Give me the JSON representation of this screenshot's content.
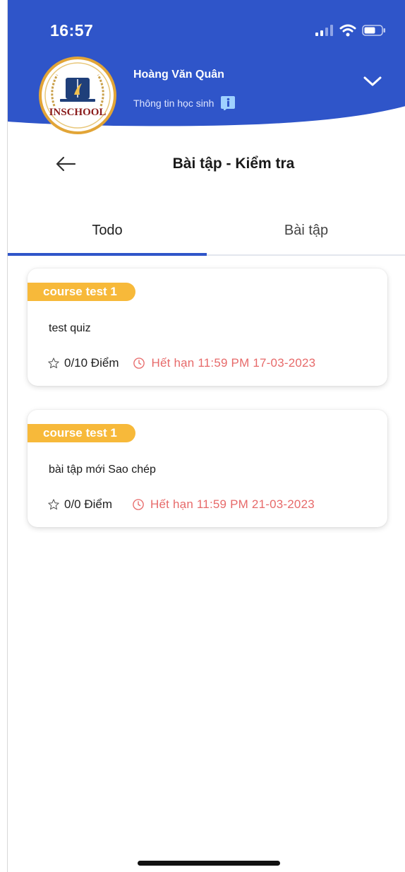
{
  "status_bar": {
    "time": "16:57",
    "icons": [
      "cellular-signal-icon",
      "wifi-icon",
      "battery-icon"
    ]
  },
  "header": {
    "logo_text": "INSCHOOL",
    "user_name": "Hoàng Văn Quân",
    "subtitle": "Thông tin học sinh",
    "info_icon": "info-icon",
    "dropdown_icon": "chevron-down-icon",
    "brand_color": "#2f55c9"
  },
  "page": {
    "back_icon": "arrow-left-icon",
    "title": "Bài tập - Kiểm tra"
  },
  "tabs": [
    {
      "label": "Todo",
      "active": true
    },
    {
      "label": "Bài tập",
      "active": false
    }
  ],
  "assignments": [
    {
      "course": "course test 1",
      "title": "test quiz",
      "score": "0/10 Điểm",
      "deadline": "Hết hạn 11:59 PM 17-03-2023"
    },
    {
      "course": "course test 1",
      "title": "bài tập mới Sao chép",
      "score": "0/0 Điểm",
      "deadline": "Hết hạn 11:59 PM 21-03-2023"
    }
  ],
  "colors": {
    "tag": "#f7b93a",
    "deadline": "#e76a6a",
    "tab_indicator": "#2f55c9"
  }
}
